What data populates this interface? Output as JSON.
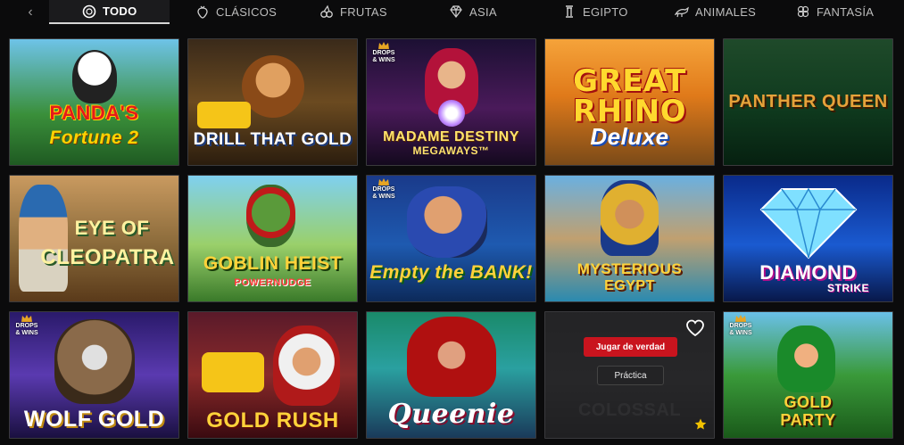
{
  "categories": [
    {
      "label": "TODO",
      "icon": "chip-icon",
      "active": true
    },
    {
      "label": "CLÁSICOS",
      "icon": "strawberry-icon"
    },
    {
      "label": "FRUTAS",
      "icon": "cherries-icon"
    },
    {
      "label": "ASIA",
      "icon": "diamond-icon"
    },
    {
      "label": "EGIPTO",
      "icon": "pillar-icon"
    },
    {
      "label": "ANIMALES",
      "icon": "animal-icon"
    },
    {
      "label": "FANTASÍA",
      "icon": "clover-icon"
    }
  ],
  "games": [
    {
      "title_l1": "PANDA'S",
      "title_l2": "Fortune 2",
      "drops_wins": false
    },
    {
      "title_l1": "DRILL THAT GOLD",
      "title_l2": "",
      "drops_wins": false
    },
    {
      "title_l1": "MADAME DESTINY",
      "title_l2": "MEGAWAYS™",
      "drops_wins": true
    },
    {
      "title_l1": "GREAT RHINO",
      "title_l2": "Deluxe",
      "drops_wins": false
    },
    {
      "title_l1": "PANTHER QUEEN",
      "title_l2": "",
      "drops_wins": false
    },
    {
      "title_l1": "EYE OF",
      "title_l2": "CLEOPATRA",
      "drops_wins": false
    },
    {
      "title_l1": "GOBLIN HEIST",
      "title_l2": "POWERNUDGE",
      "drops_wins": false
    },
    {
      "title_l1": "Empty the BANK!",
      "title_l2": "",
      "drops_wins": true
    },
    {
      "title_l1": "MYSTERIOUS",
      "title_l2": "EGYPT",
      "drops_wins": false
    },
    {
      "title_l1": "DIAMOND",
      "title_l2": "STRIKE",
      "drops_wins": false
    },
    {
      "title_l1": "WOLF GOLD",
      "title_l2": "",
      "drops_wins": true
    },
    {
      "title_l1": "GOLD RUSH",
      "title_l2": "",
      "drops_wins": false
    },
    {
      "title_l1": "Queenie",
      "title_l2": "",
      "drops_wins": false
    },
    {
      "title_l1": "COLOSSAL",
      "title_l2": "",
      "drops_wins": false
    },
    {
      "title_l1": "GOLD",
      "title_l2": "PARTY",
      "drops_wins": true
    }
  ],
  "drops_wins_label_l1": "DROPS",
  "drops_wins_label_l2": "& WINS",
  "hover": {
    "play_real_label": "Jugar de verdad",
    "play_demo_label": "Práctica"
  },
  "colors": {
    "accent_red": "#c9141e",
    "favorite_star": "#f2c200"
  }
}
